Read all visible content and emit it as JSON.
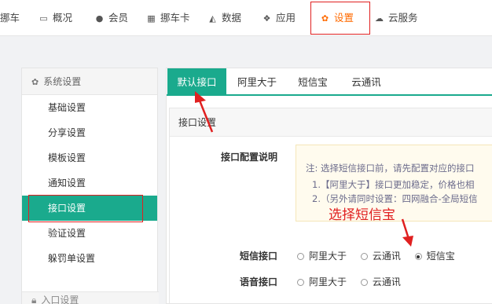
{
  "topnav": {
    "items": [
      {
        "label": "挪车",
        "icon": "truck-icon",
        "glyph": ""
      },
      {
        "label": "概况",
        "icon": "monitor-icon",
        "glyph": "▭"
      },
      {
        "label": "会员",
        "icon": "user-icon",
        "glyph": "●"
      },
      {
        "label": "挪车卡",
        "icon": "barcode-icon",
        "glyph": "▦"
      },
      {
        "label": "数据",
        "icon": "area-chart-icon",
        "glyph": "◭"
      },
      {
        "label": "应用",
        "icon": "cubes-icon",
        "glyph": "❖"
      },
      {
        "label": "设置",
        "icon": "gear-icon",
        "glyph": "✿"
      },
      {
        "label": "云服务",
        "icon": "cloud-icon",
        "glyph": "☁"
      }
    ],
    "active_index": 6
  },
  "sidebar": {
    "header": "系统设置",
    "header_icon": "gear-icon",
    "items": [
      {
        "label": "基础设置"
      },
      {
        "label": "分享设置"
      },
      {
        "label": "模板设置"
      },
      {
        "label": "通知设置"
      },
      {
        "label": "接口设置"
      },
      {
        "label": "验证设置"
      },
      {
        "label": "躲罚单设置"
      }
    ],
    "active_index": 4,
    "footer": "入口设置",
    "footer_icon": "lock-icon"
  },
  "tabs": [
    {
      "label": "默认接口"
    },
    {
      "label": "阿里大于"
    },
    {
      "label": "短信宝"
    },
    {
      "label": "云通讯"
    }
  ],
  "panel": {
    "title": "接口设置",
    "config_label": "接口配置说明",
    "note_lines": [
      "注: 选择短信接口前，请先配置对应的接口",
      "1.【阿里大于】接口更加稳定，价格也相",
      "2.（另外请同时设置：四网融合-全局短信"
    ],
    "sms": {
      "label": "短信接口",
      "options": [
        "阿里大于",
        "云通讯",
        "短信宝"
      ],
      "selected": "短信宝"
    },
    "voice": {
      "label": "语音接口",
      "options": [
        "阿里大于",
        "云通讯"
      ],
      "selected": ""
    }
  },
  "annotation": "选择短信宝",
  "colors": {
    "accent": "#1aaa8d",
    "annotation": "#e02020",
    "active_nav": "#ff6a00"
  }
}
